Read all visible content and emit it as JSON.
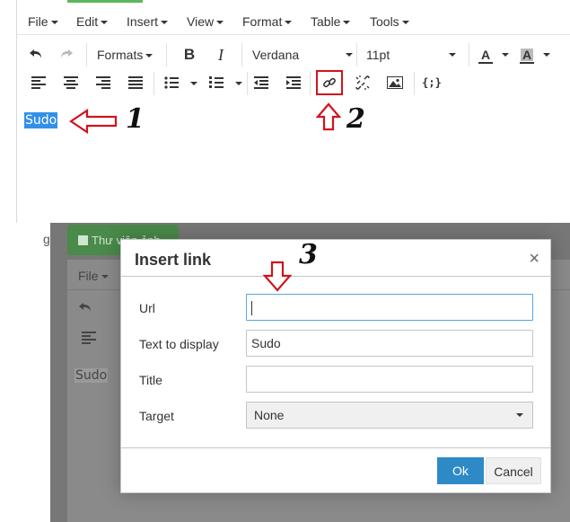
{
  "menus": [
    "File",
    "Edit",
    "Insert",
    "View",
    "Format",
    "Table",
    "Tools"
  ],
  "toolbar": {
    "formats_label": "Formats",
    "font_family": "Verdana",
    "font_size": "11pt",
    "text_color_letter": "A",
    "bg_color_letter": "A",
    "bold_letter": "B",
    "italic_letter": "I",
    "code_sample": "{;}"
  },
  "editor": {
    "selected_text": "Sudo"
  },
  "annotations": [
    "1",
    "2",
    "3"
  ],
  "background": {
    "gallery_button": "Thư viện ảnh",
    "file_menu": "File",
    "editor_text": "Sudo",
    "left_letter": "g"
  },
  "dialog": {
    "title": "Insert link",
    "close_icon": "×",
    "fields": {
      "url": {
        "label": "Url",
        "value": ""
      },
      "text": {
        "label": "Text to display",
        "value": "Sudo"
      },
      "title": {
        "label": "Title",
        "value": ""
      },
      "target": {
        "label": "Target",
        "value": "None"
      }
    },
    "ok_label": "Ok",
    "cancel_label": "Cancel"
  },
  "colors": {
    "accent": "#2d8ac7",
    "selection": "#3390e8",
    "annotation_red": "#d0141e",
    "green": "#5cb85c"
  }
}
